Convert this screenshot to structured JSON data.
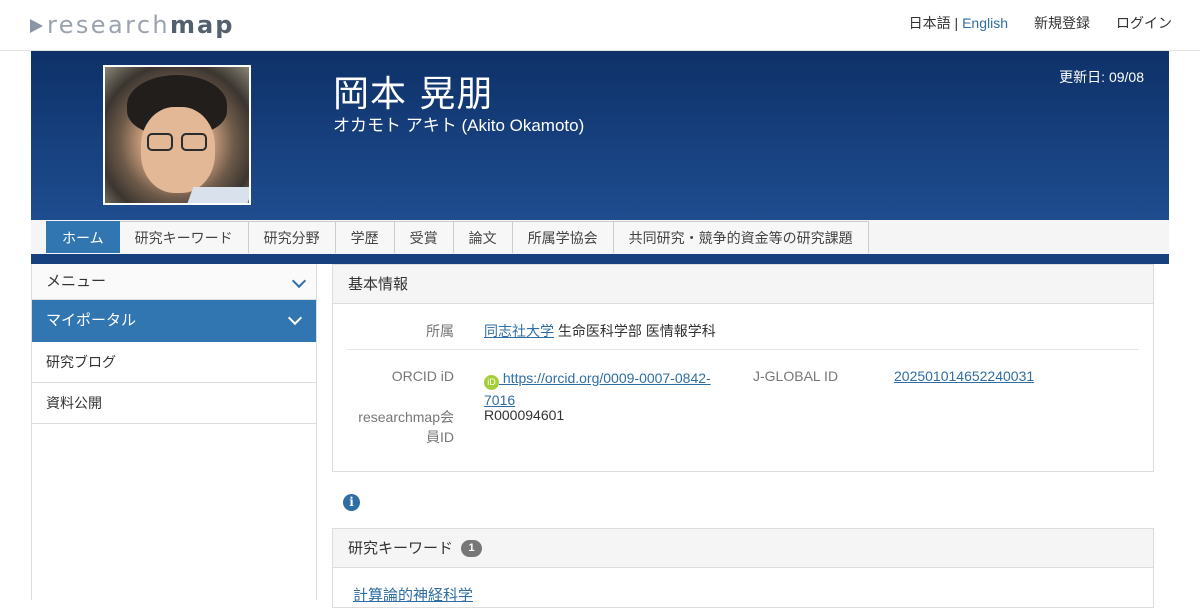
{
  "header": {
    "logo_light": "research",
    "logo_dark": "map",
    "lang_ja": "日本語",
    "lang_sep": " | ",
    "lang_en": "English",
    "signup": "新規登録",
    "login": "ログイン"
  },
  "profile": {
    "name_ja": "岡本 晃朋",
    "name_kana": "オカモト アキト  (Akito Okamoto)",
    "updated": "更新日: 09/08"
  },
  "tabs": [
    {
      "label": "ホーム",
      "active": true
    },
    {
      "label": "研究キーワード"
    },
    {
      "label": "研究分野"
    },
    {
      "label": "学歴"
    },
    {
      "label": "受賞"
    },
    {
      "label": "論文"
    },
    {
      "label": "所属学協会"
    },
    {
      "label": "共同研究・競争的資金等の研究課題"
    }
  ],
  "sidebar": {
    "menu_label": "メニュー",
    "portal_label": "マイポータル",
    "items": [
      {
        "label": "研究ブログ"
      },
      {
        "label": "資料公開"
      }
    ]
  },
  "basic_info": {
    "title": "基本情報",
    "affiliation_label": "所属",
    "affiliation_link": "同志社大学",
    "affiliation_rest": " 生命医科学部 医情報学科",
    "orcid_label": "ORCID iD",
    "orcid_icon_text": "iD",
    "orcid_url": " https://orcid.org/0009-0007-0842-7016",
    "jglobal_label": "J-GLOBAL ID",
    "jglobal_value": "202501014652240031",
    "rm_id_label": "researchmap会員ID",
    "rm_id_value": "R000094601"
  },
  "keywords": {
    "title": "研究キーワード",
    "count": "1",
    "items": [
      {
        "label": "計算論的神経科学"
      }
    ]
  },
  "colors": {
    "banner": "#17407e",
    "accent": "#3276b1",
    "link": "#2f6ea4"
  }
}
